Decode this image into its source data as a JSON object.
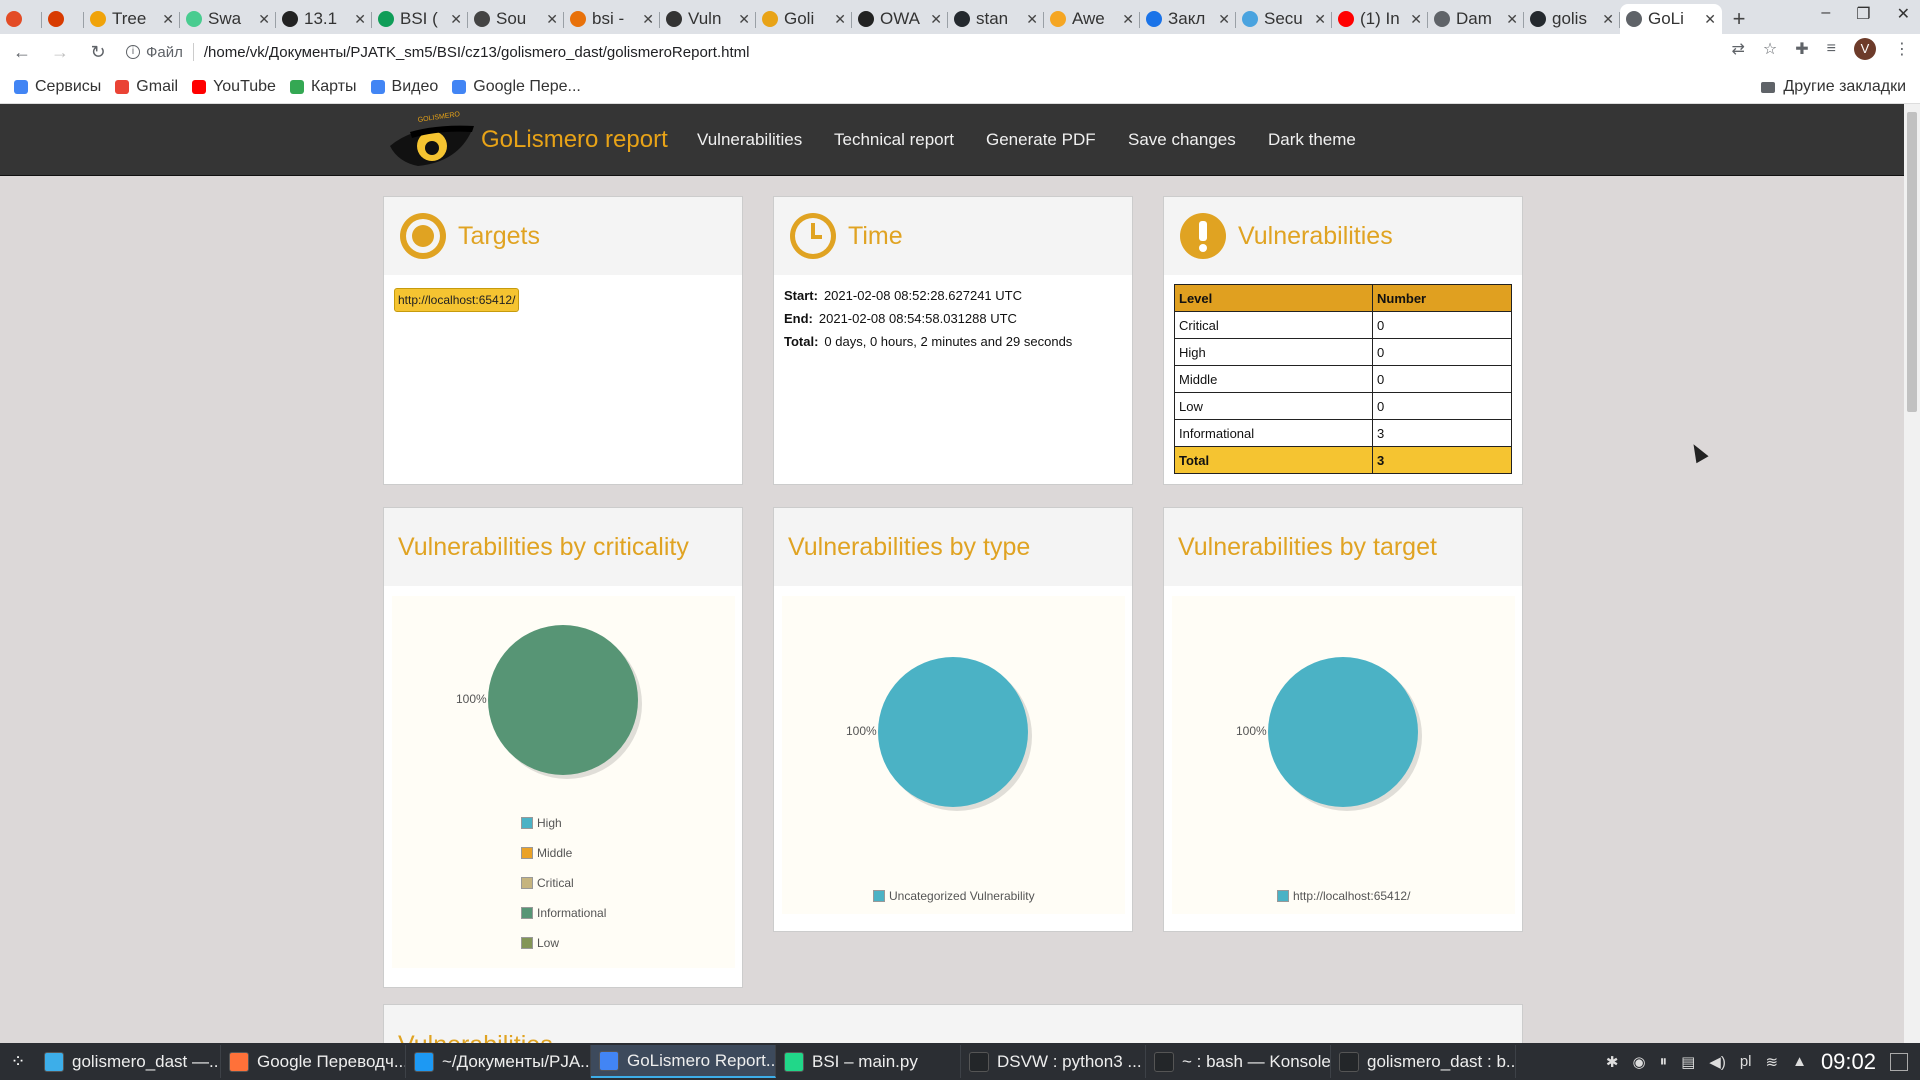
{
  "browser": {
    "tabs": [
      {
        "title": "",
        "favicon": "adobe-icon",
        "color": "#e34c26"
      },
      {
        "title": "",
        "favicon": "office-icon",
        "color": "#d83b01"
      },
      {
        "title": "Tree",
        "favicon": "tree-icon",
        "color": "#f0a30a"
      },
      {
        "title": "Swa",
        "favicon": "swagger-icon",
        "color": "#49cc90"
      },
      {
        "title": "13.1",
        "favicon": "link-icon",
        "color": "#222222"
      },
      {
        "title": "BSI (",
        "favicon": "sheets-icon",
        "color": "#0f9d58"
      },
      {
        "title": "Sou",
        "favicon": "source-icon",
        "color": "#444444"
      },
      {
        "title": "bsi -",
        "favicon": "cloud-icon",
        "color": "#e8710a"
      },
      {
        "title": "Vuln",
        "favicon": "github-icon",
        "color": "#333333"
      },
      {
        "title": "Goli",
        "favicon": "golismero-icon",
        "color": "#e8a317"
      },
      {
        "title": "OWA",
        "favicon": "owasp-icon",
        "color": "#222222"
      },
      {
        "title": "stan",
        "favicon": "github-icon",
        "color": "#24292e"
      },
      {
        "title": "Awe",
        "favicon": "emoji-icon",
        "color": "#f5a623"
      },
      {
        "title": "Закл",
        "favicon": "star-icon",
        "color": "#1a73e8"
      },
      {
        "title": "Secu",
        "favicon": "security-icon",
        "color": "#4aa3df"
      },
      {
        "title": "(1) In",
        "favicon": "youtube-icon",
        "color": "#ff0000"
      },
      {
        "title": "Dam",
        "favicon": "globe-icon",
        "color": "#5f6368"
      },
      {
        "title": "golis",
        "favicon": "github-icon",
        "color": "#24292e"
      },
      {
        "title": "GoLi",
        "favicon": "globe-icon",
        "color": "#5f6368",
        "active": true
      }
    ],
    "new_tab": "+",
    "address": {
      "scheme": "Файл",
      "url": "/home/vk/Документы/PJATK_sm5/BSI/cz13/golismero_dast/golismeroReport.html"
    },
    "profile_initial": "V",
    "bookmarks": [
      {
        "label": "Сервисы",
        "icon": "apps-icon",
        "color": "#4285f4"
      },
      {
        "label": "Gmail",
        "icon": "gmail-icon",
        "color": "#ea4335"
      },
      {
        "label": "YouTube",
        "icon": "youtube-icon",
        "color": "#ff0000"
      },
      {
        "label": "Карты",
        "icon": "maps-icon",
        "color": "#34a853"
      },
      {
        "label": "Видео",
        "icon": "google-icon",
        "color": "#4285f4"
      },
      {
        "label": "Google Пере...",
        "icon": "translate-icon",
        "color": "#4285f4"
      }
    ],
    "other_bookmarks": "Другие закладки"
  },
  "report": {
    "brand": "GoLismero report",
    "logo_text": "GOLISMERO",
    "nav": [
      "Vulnerabilities",
      "Technical report",
      "Generate PDF",
      "Save changes",
      "Dark theme"
    ],
    "targets": {
      "title": "Targets",
      "items": [
        "http://localhost:65412/"
      ]
    },
    "time": {
      "title": "Time",
      "start_label": "Start:",
      "start": "2021-02-08 08:52:28.627241 UTC",
      "end_label": "End:",
      "end": "2021-02-08 08:54:58.031288 UTC",
      "total_label": "Total:",
      "total": "0 days, 0 hours, 2 minutes and 29 seconds"
    },
    "vulns": {
      "title": "Vulnerabilities",
      "head": [
        "Level",
        "Number"
      ],
      "rows": [
        [
          "Critical",
          "0"
        ],
        [
          "High",
          "0"
        ],
        [
          "Middle",
          "0"
        ],
        [
          "Low",
          "0"
        ],
        [
          "Informational",
          "3"
        ]
      ],
      "total": [
        "Total",
        "3"
      ]
    },
    "chart_titles": {
      "criticality": "Vulnerabilities by criticality",
      "type": "Vulnerabilities by type",
      "target": "Vulnerabilities by target"
    },
    "next_section_title": "Vulnerabilities",
    "colors": {
      "accent": "#e0a322",
      "navbar": "#353535",
      "tag": "#f5c431"
    }
  },
  "chart_data": [
    {
      "type": "pie",
      "title": "Vulnerabilities by criticality",
      "labels": [
        "High",
        "Middle",
        "Critical",
        "Informational",
        "Low"
      ],
      "values": [
        0,
        0,
        0,
        3,
        0
      ],
      "colors": [
        "#4bb2c5",
        "#eaa228",
        "#c5b47f",
        "#579575",
        "#839557"
      ],
      "slice_label": "100%",
      "legend": "bottom"
    },
    {
      "type": "pie",
      "title": "Vulnerabilities by type",
      "labels": [
        "Uncategorized Vulnerability"
      ],
      "values": [
        3
      ],
      "colors": [
        "#4bb2c5"
      ],
      "slice_label": "100%",
      "legend": "bottom"
    },
    {
      "type": "pie",
      "title": "Vulnerabilities by target",
      "labels": [
        "http://localhost:65412/"
      ],
      "values": [
        3
      ],
      "colors": [
        "#4bb2c5"
      ],
      "slice_label": "100%",
      "legend": "bottom"
    }
  ],
  "taskbar": {
    "tasks": [
      {
        "label": "golismero_dast —...",
        "icon": "folder-icon",
        "color": "#3daee9"
      },
      {
        "label": "Google Переводч...",
        "icon": "firefox-icon",
        "color": "#ff7139"
      },
      {
        "label": "~/Документы/PJA...",
        "icon": "kate-icon",
        "color": "#1d99f3"
      },
      {
        "label": "GoLismero Report...",
        "icon": "chrome-icon",
        "color": "#4285f4",
        "active": true
      },
      {
        "label": "BSI – main.py",
        "icon": "pycharm-icon",
        "color": "#21d789"
      },
      {
        "label": "DSVW : python3 ...",
        "icon": "terminal-icon",
        "color": "#232629"
      },
      {
        "label": "~ : bash — Konsole",
        "icon": "terminal-icon",
        "color": "#232629"
      },
      {
        "label": "golismero_dast : b...",
        "icon": "terminal-icon",
        "color": "#232629"
      }
    ],
    "keyboard_layout": "pl",
    "clock": "09:02"
  }
}
